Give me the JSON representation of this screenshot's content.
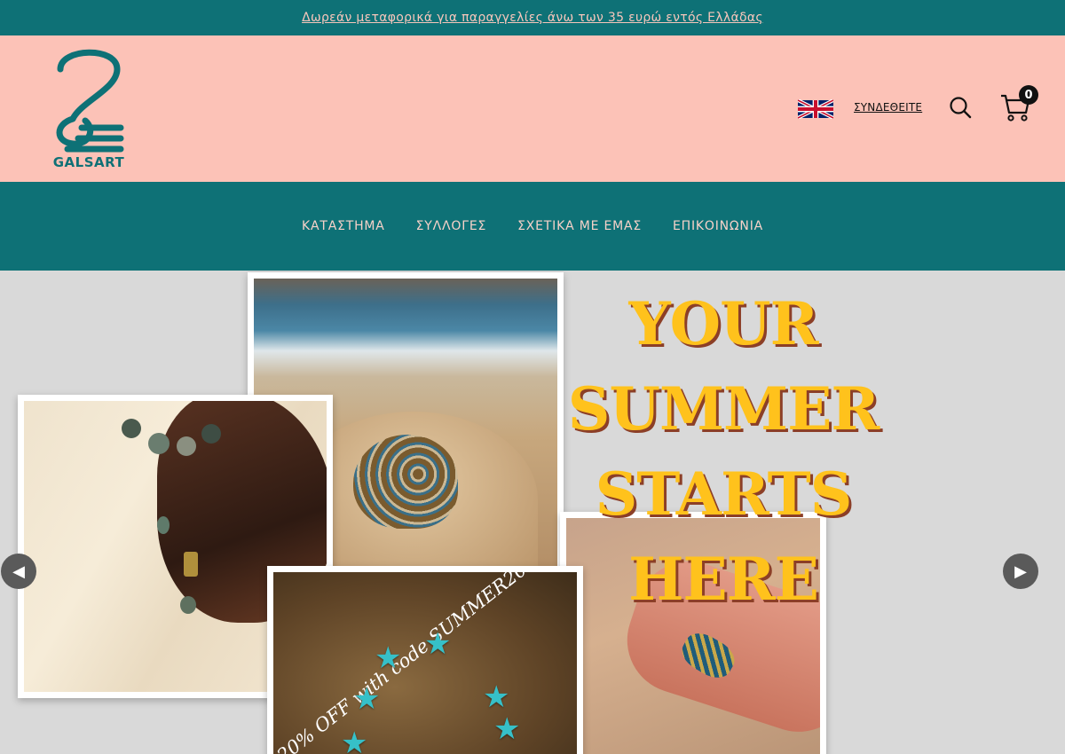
{
  "announcement": "Δωρεάν μεταφορικά για παραγγελίες άνω των 35 ευρώ εντός Ελλάδας",
  "header": {
    "logo_text": "GALSART",
    "login_label": "ΣΥΝΔΕΘΕΙΤΕ",
    "cart_count": "0",
    "language_flag": "uk-flag-icon",
    "accent_color": "#0e7176",
    "header_bg": "#fcc2b7"
  },
  "nav": {
    "items": [
      {
        "label": "ΚΑΤΑΣΤΗΜΑ"
      },
      {
        "label": "ΣΥΛΛΟΓΕΣ"
      },
      {
        "label": "ΣΧΕΤΙΚΑ ΜΕ ΕΜΑΣ"
      },
      {
        "label": "ΕΠΙΚΟΙΝΩΝΙΑ"
      }
    ]
  },
  "hero": {
    "headline_lines": [
      "YOUR",
      "SUMMER",
      "STARTS",
      "HERE"
    ],
    "promo_text": "20% OFF with code SUMMER20",
    "prev_icon": "chevron-left-icon",
    "next_icon": "chevron-right-icon"
  }
}
